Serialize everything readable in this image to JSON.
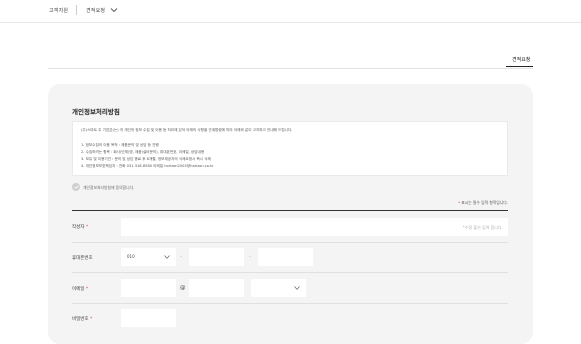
{
  "topbar": {
    "crumb_home": "고객지원",
    "crumb_current": "견적요청"
  },
  "tab": {
    "label": "견적요청"
  },
  "privacy": {
    "title": "개인정보처리방침",
    "intro": "(주)스마트 주 기업은(는) 귀 개인의 정보 수집 및 이용 등 처리에 있어 아래의 사항을 관계법령에 따라 아래와 같이 고지하고 안내해 드립니다.",
    "lines": [
      "1. 정보수집의 이용 목적 : 제품문의 및 상담 등 진행",
      "2. 수집하려는 항목 : 회사(단체)명, 제품(설비문의), 휴대폰번호, 이메일, 상담내용",
      "3. 보유 및 이용기간 : 문의 및 상담 종료 후 6개월, 정보제공자의 삭제요청시 즉시 삭제",
      "4. 개인정보보호책임자 : 전화 031-316-8580 이메일 horizon2003@horizon.co.kr"
    ],
    "agree_label": "개인정보처리방침에 동의합니다."
  },
  "form": {
    "required_note_star": "*",
    "required_note": "표시는 필수 입력 항목입니다.",
    "author_label": "작성자",
    "author_placeholder": "*수정 불가 입력 합니다.",
    "phone_label": "휴대폰번호",
    "phone_prefix": "010",
    "phone_dash": "-",
    "email_label": "이메일",
    "email_at": "@",
    "password_label": "비밀번호",
    "required_star": "*"
  }
}
